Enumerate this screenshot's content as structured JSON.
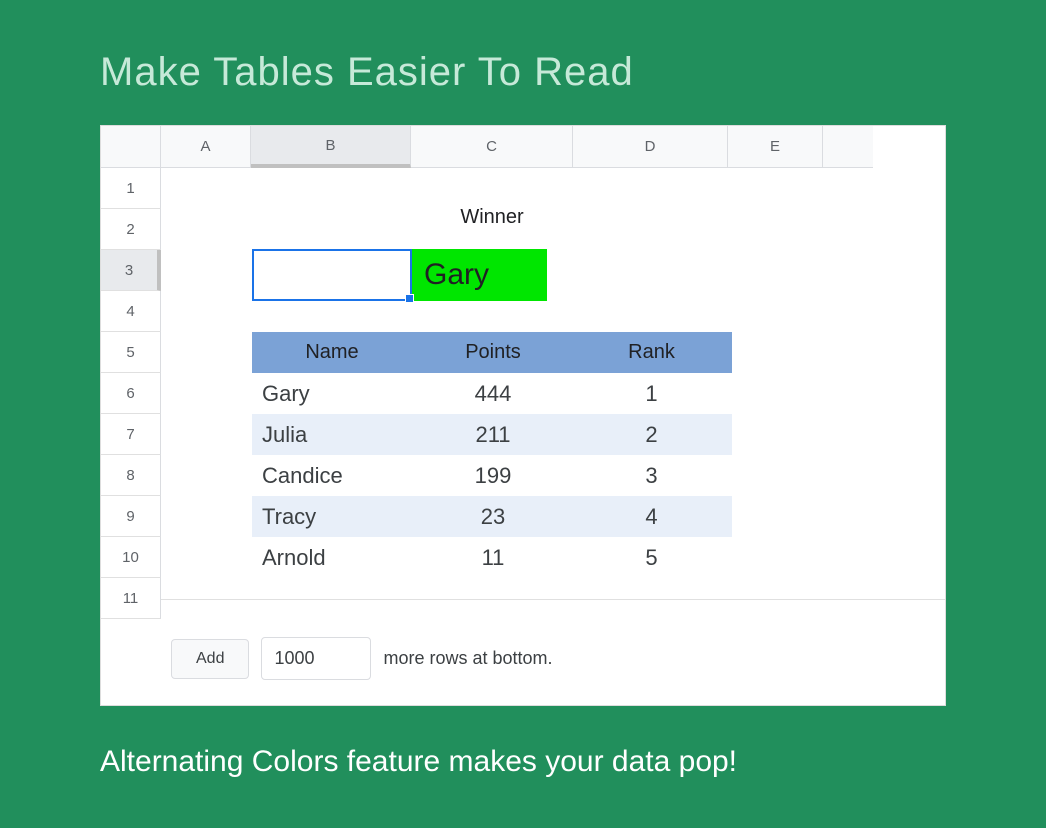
{
  "title": "Make Tables Easier To Read",
  "subtitle": "Alternating Colors feature makes your data pop!",
  "sheet": {
    "columns": [
      "A",
      "B",
      "C",
      "D",
      "E"
    ],
    "rows": [
      "1",
      "2",
      "3",
      "4",
      "5",
      "6",
      "7",
      "8",
      "9",
      "10",
      "11"
    ],
    "active_cell": "B3",
    "winner": {
      "label": "Winner",
      "value": "Gary"
    },
    "table": {
      "headers": {
        "name": "Name",
        "points": "Points",
        "rank": "Rank"
      },
      "rows": [
        {
          "name": "Gary",
          "points": "444",
          "rank": "1"
        },
        {
          "name": "Julia",
          "points": "211",
          "rank": "2"
        },
        {
          "name": "Candice",
          "points": "199",
          "rank": "3"
        },
        {
          "name": "Tracy",
          "points": "23",
          "rank": "4"
        },
        {
          "name": "Arnold",
          "points": "11",
          "rank": "5"
        }
      ]
    }
  },
  "addrows": {
    "button_label": "Add",
    "count": "1000",
    "suffix": "more rows at bottom."
  }
}
